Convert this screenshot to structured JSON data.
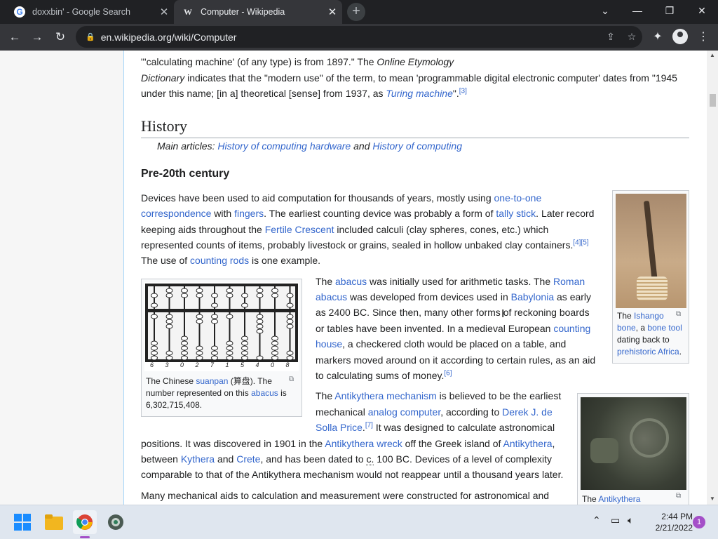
{
  "browser": {
    "tabs": [
      {
        "favicon": "G",
        "title": "doxxbin' - Google Search",
        "close": "✕"
      },
      {
        "favicon": "W",
        "title": "Computer - Wikipedia",
        "close": "✕"
      }
    ],
    "new_tab": "+",
    "url": "en.wikipedia.org/wiki/Computer"
  },
  "article": {
    "intro_line1_a": "\"'calculating machine' (of any type) is from 1897.\" The ",
    "intro_line1_b": "Online Etymology",
    "intro_line2_a": "Dictionary",
    "intro_line2_b": " indicates that the \"modern use\" of the term, to mean 'programmable digital electronic computer' dates from \"1945",
    "intro_line3_a": "under this name; [in a] theoretical [sense] from 1937, as ",
    "intro_line3_link": "Turing machine",
    "intro_line3_b": "\".",
    "intro_ref": "[3]",
    "history_heading": "History",
    "hatnote_prefix": "Main articles: ",
    "hatnote_link1": "History of computing hardware",
    "hatnote_and": " and ",
    "hatnote_link2": "History of computing",
    "pre20_heading": "Pre-20th century",
    "p1": {
      "l1a": "Devices have been used to aid computation for thousands of years, mostly using ",
      "l1link": "one-to-one",
      "l2link1": "correspondence",
      "l2a": " with ",
      "l2link2": "fingers",
      "l2b": ". The earliest counting device was probably a form of ",
      "l2link3": "tally stick",
      "l2c": ". Later record",
      "l3a": "keeping aids throughout the ",
      "l3link": "Fertile Crescent",
      "l3b": " included calculi (clay spheres, cones, etc.) which",
      "l4a": "represented counts of items, probably livestock or grains, sealed in hollow unbaked clay containers.",
      "l4ref": "[4][5]",
      "l5a": "The use of ",
      "l5link": "counting rods",
      "l5b": " is one example."
    },
    "p2": {
      "l1a": "The ",
      "l1link1": "abacus",
      "l1b": " was initially used for arithmetic tasks. The ",
      "l1link2": "Roman",
      "l2link": "abacus",
      "l2a": " was developed from devices used in ",
      "l2link2": "Babylonia",
      "l2b": " as early",
      "l3": "as 2400 BC. Since then, many other forms of reckoning boards",
      "l4a": "or tables have been invented. In a medieval European ",
      "l4link": "counting",
      "l5link": "house",
      "l5a": ", a checkered cloth would be placed on a table, and",
      "l6": "markers moved around on it according to certain rules, as an aid",
      "l7": "to calculating sums of money.",
      "l7ref": "[6]"
    },
    "p3": {
      "l1a": "The ",
      "l1link": "Antikythera mechanism",
      "l1b": " is believed to be the earliest",
      "l2a": "mechanical ",
      "l2link1": "analog computer",
      "l2b": ", according to ",
      "l2link2": "Derek J. de",
      "l3link": "Solla Price",
      "l3ref": "[7]",
      "l3a": " It was designed to calculate astronomical",
      "l4a": "positions. It was discovered in 1901 in the ",
      "l4link1": "Antikythera wreck",
      "l4b": " off the Greek island of ",
      "l4link2": "Antikythera",
      "l4c": ",",
      "l5a": "between ",
      "l5link1": "Kythera",
      "l5b": " and ",
      "l5link2": "Crete",
      "l5c": ", and has been dated to ",
      "l5link3": "c.",
      "l5d": " 100 BC. Devices of a level of complexity",
      "l6": "comparable to that of the Antikythera mechanism would not reappear until a thousand years later."
    },
    "p4_start": "Many mechanical aids to calculation and measurement were constructed for astronomical and",
    "ishango": {
      "cap_a": "The ",
      "cap_link1": "Ishango",
      "cap_link2": "bone",
      "cap_b": ", a ",
      "cap_link3": "bone tool",
      "cap_c": "dating back to",
      "cap_link4": "prehistoric Africa",
      "cap_d": "."
    },
    "suanpan": {
      "cap_a": "The Chinese ",
      "cap_link1": "suanpan",
      "cap_b": " (算盘). The",
      "cap_c": "number represented on this ",
      "cap_link2": "abacus",
      "cap_d": " is",
      "cap_e": "6,302,715,408.",
      "digits": "6 3 0 2 7 1 5 4 0 8"
    },
    "antikythera": {
      "cap_a": "The ",
      "cap_link": "Antikythera"
    }
  },
  "taskbar": {
    "time": "2:44 PM",
    "date": "2/21/2022",
    "notifications": "1"
  }
}
